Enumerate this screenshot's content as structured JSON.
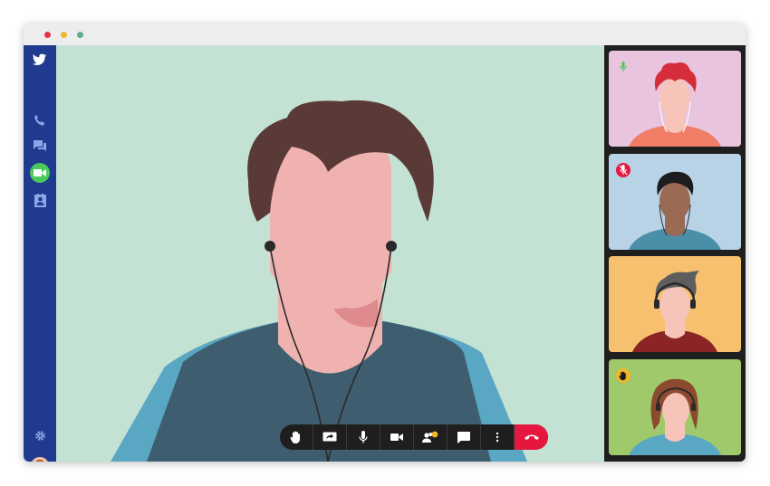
{
  "app": {
    "colors": {
      "sidebar": "#1f3a8f",
      "active_call": "#4bc95a",
      "end_call": "#e5173f",
      "stage_background": "#c3e2d4",
      "control_bar": "#1e1e1e"
    }
  },
  "window_controls": [
    "close",
    "minimize",
    "maximize"
  ],
  "sidebar": {
    "logo_icon": "bird-logo-icon",
    "items": [
      {
        "icon": "phone-icon",
        "active": false
      },
      {
        "icon": "chat-icon",
        "active": false
      },
      {
        "icon": "video-camera-icon",
        "active": true
      },
      {
        "icon": "contacts-icon",
        "active": false
      }
    ],
    "bottom": [
      {
        "icon": "gear-icon"
      },
      {
        "icon": "user-avatar"
      }
    ]
  },
  "participants": [
    {
      "tile_color": "#e8c4de",
      "status_icon": "microphone-active-icon",
      "hair": "#d62d3b",
      "shirt": "#f07e67"
    },
    {
      "tile_color": "#b8d3e6",
      "status_icon": "microphone-muted-icon",
      "hair": "#1d1d1d",
      "shirt": "#4a8ea8"
    },
    {
      "tile_color": "#f6c06e",
      "status_icon": "none",
      "hair": "#5e5e5e",
      "shirt": "#8b2424"
    },
    {
      "tile_color": "#9fc96a",
      "status_icon": "raised-hand-icon",
      "hair": "#8c4a2f",
      "shirt": "#5aa7c4"
    }
  ],
  "controls": [
    {
      "icon": "raise-hand-icon"
    },
    {
      "icon": "share-screen-icon"
    },
    {
      "icon": "microphone-icon"
    },
    {
      "icon": "video-camera-icon"
    },
    {
      "icon": "participants-icon",
      "notification": true
    },
    {
      "icon": "chat-bubble-icon"
    },
    {
      "icon": "more-options-icon"
    },
    {
      "icon": "end-call-icon"
    }
  ]
}
